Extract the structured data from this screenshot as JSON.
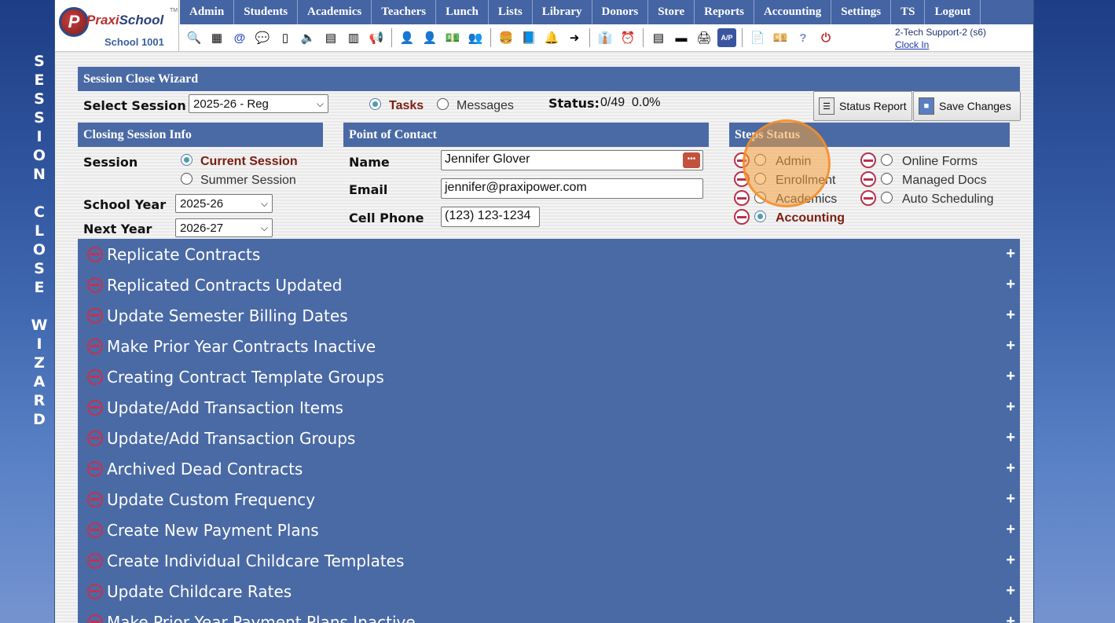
{
  "side_title": [
    "S",
    "E",
    "S",
    "S",
    "I",
    "O",
    "N",
    "",
    "C",
    "L",
    "O",
    "S",
    "E",
    "",
    "W",
    "I",
    "Z",
    "A",
    "R",
    "D"
  ],
  "logo": {
    "praxi": "Praxi",
    "school": "School",
    "tm": "TM",
    "school_name": "School 1001"
  },
  "nav": [
    "Admin",
    "Students",
    "Academics",
    "Teachers",
    "Lunch",
    "Lists",
    "Library",
    "Donors",
    "Store",
    "Reports",
    "Accounting",
    "Settings",
    "TS",
    "Logout"
  ],
  "toolbar_icons": [
    "search-icon",
    "grid-icon",
    "email-icon",
    "chat-icon",
    "phone-icon",
    "speaker-icon",
    "calculator-icon",
    "calendar-icon",
    "megaphone-icon",
    "|",
    "user-add-icon",
    "user-icon",
    "money-icon",
    "users-icon",
    "|",
    "lunch-icon",
    "book-icon",
    "bell-icon",
    "export-icon",
    "|",
    "teacher-icon",
    "clock-icon",
    "|",
    "table-icon",
    "ticket-icon",
    "print-icon",
    "ap-icon",
    "|",
    "pdf-icon",
    "cash-icon",
    "help-icon",
    "power-icon"
  ],
  "user": {
    "name": "2-Tech Support-2 (s6)",
    "clock_in": "Clock In"
  },
  "wizard": {
    "title": "Session Close Wizard",
    "select_session_label": "Select Session",
    "select_session_value": "2025-26 - Reg",
    "tasks_label": "Tasks",
    "messages_label": "Messages",
    "status_label": "Status:",
    "status_value": "0/49  0.0%",
    "status_report_button": "Status Report",
    "save_changes_button": "Save Changes"
  },
  "closing_info": {
    "title": "Closing Session Info",
    "session_label": "Session",
    "current_session": "Current Session",
    "summer_session": "Summer Session",
    "school_year_label": "School Year",
    "school_year_value": "2025-26",
    "next_year_label": "Next Year",
    "next_year_value": "2026-27"
  },
  "contact": {
    "title": "Point of Contact",
    "name_label": "Name",
    "name_value": "Jennifer Glover",
    "email_label": "Email",
    "email_value": "jennifer@praxipower.com",
    "phone_label": "Cell Phone",
    "phone_value": "(123) 123-1234"
  },
  "steps": {
    "title": "Steps Status",
    "col1": [
      "Admin",
      "Enrollment",
      "Academics",
      "Accounting"
    ],
    "col2": [
      "Online Forms",
      "Managed Docs",
      "Auto Scheduling"
    ],
    "selected": "Accounting"
  },
  "tasks": [
    "Replicate Contracts",
    "Replicated Contracts Updated",
    "Update Semester Billing Dates",
    "Make Prior Year Contracts Inactive",
    "Creating Contract Template Groups",
    "Update/Add Transaction Items",
    "Update/Add Transaction Groups",
    "Archived Dead Contracts",
    "Update Custom Frequency",
    "Create New Payment Plans",
    "Create Individual Childcare Templates",
    "Update Childcare Rates",
    "Make Prior Year Payment Plans Inactive"
  ],
  "expand_symbol": "+"
}
